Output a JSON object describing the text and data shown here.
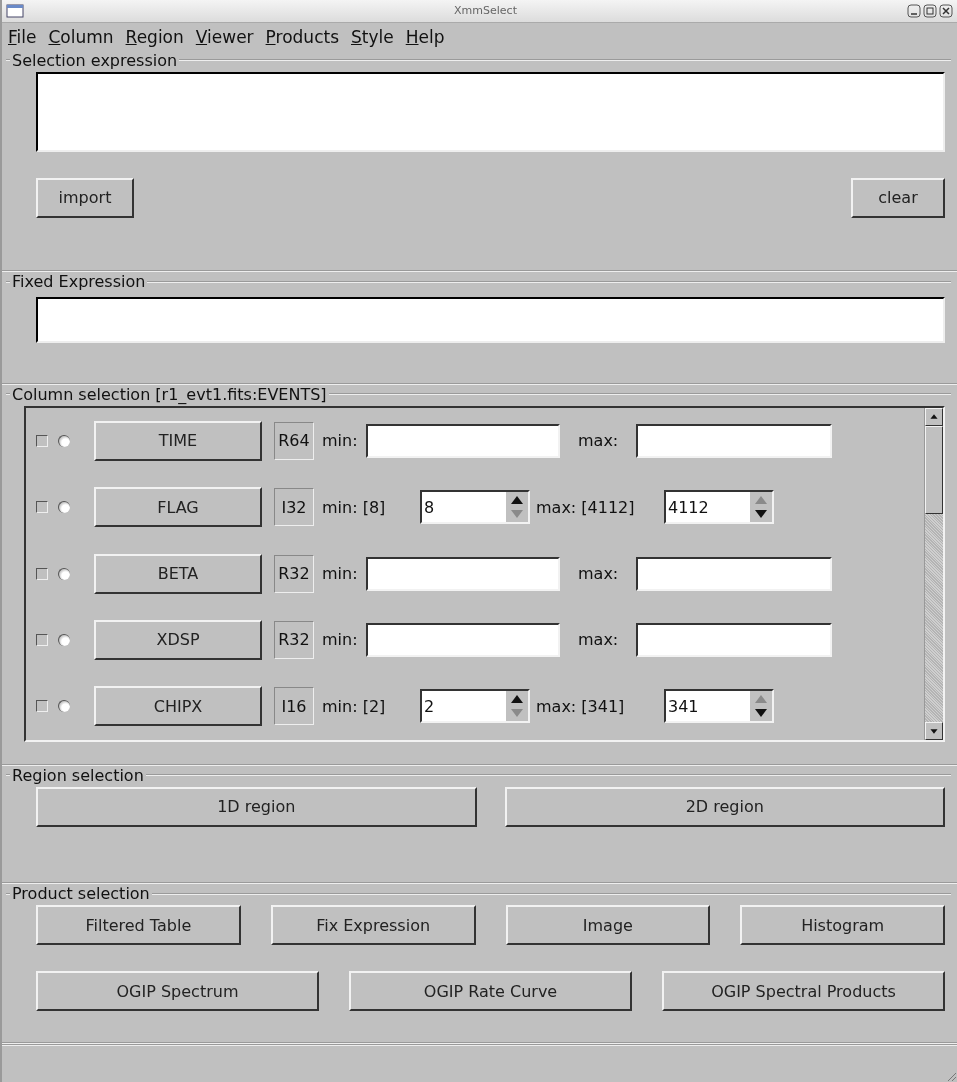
{
  "window": {
    "title": "XmmSelect"
  },
  "menu": [
    "File",
    "Column",
    "Region",
    "Viewer",
    "Products",
    "Style",
    "Help"
  ],
  "selection_expression": {
    "title": "Selection expression",
    "buttons": [
      "import",
      "clear"
    ]
  },
  "fixed_expression": {
    "title": "Fixed Expression"
  },
  "column_selection": {
    "title": "Column selection [r1_evt1.fits:EVENTS]",
    "rows": [
      {
        "kind": "range",
        "checked": false,
        "selected": false,
        "name": "TIME",
        "type": "R64",
        "min_label": "min:",
        "max_label": "max:"
      },
      {
        "kind": "spin",
        "checked": false,
        "selected": false,
        "name": "FLAG",
        "type": "I32",
        "min_label": "min: [8]",
        "min_value": "8",
        "min_up_enabled": true,
        "min_down_enabled": false,
        "max_label": "max: [4112]",
        "max_value": "4112",
        "max_up_enabled": false,
        "max_down_enabled": true
      },
      {
        "kind": "range",
        "checked": false,
        "selected": false,
        "name": "BETA",
        "type": "R32",
        "min_label": "min:",
        "max_label": "max:"
      },
      {
        "kind": "range",
        "checked": false,
        "selected": false,
        "name": "XDSP",
        "type": "R32",
        "min_label": "min:",
        "max_label": "max:"
      },
      {
        "kind": "spin",
        "checked": false,
        "selected": false,
        "name": "CHIPX",
        "type": "I16",
        "min_label": "min: [2]",
        "min_value": "2",
        "min_up_enabled": true,
        "min_down_enabled": false,
        "max_label": "max: [341]",
        "max_value": "341",
        "max_up_enabled": false,
        "max_down_enabled": true
      }
    ]
  },
  "region_selection": {
    "title": "Region selection",
    "buttons": [
      "1D region",
      "2D region"
    ]
  },
  "product_selection": {
    "title": "Product selection",
    "buttons_row_1": [
      "Filtered Table",
      "Fix Expression",
      "Image",
      "Histogram"
    ],
    "buttons_row_2": [
      "OGIP Spectrum",
      "OGIP Rate Curve",
      "OGIP Spectral Products"
    ]
  }
}
